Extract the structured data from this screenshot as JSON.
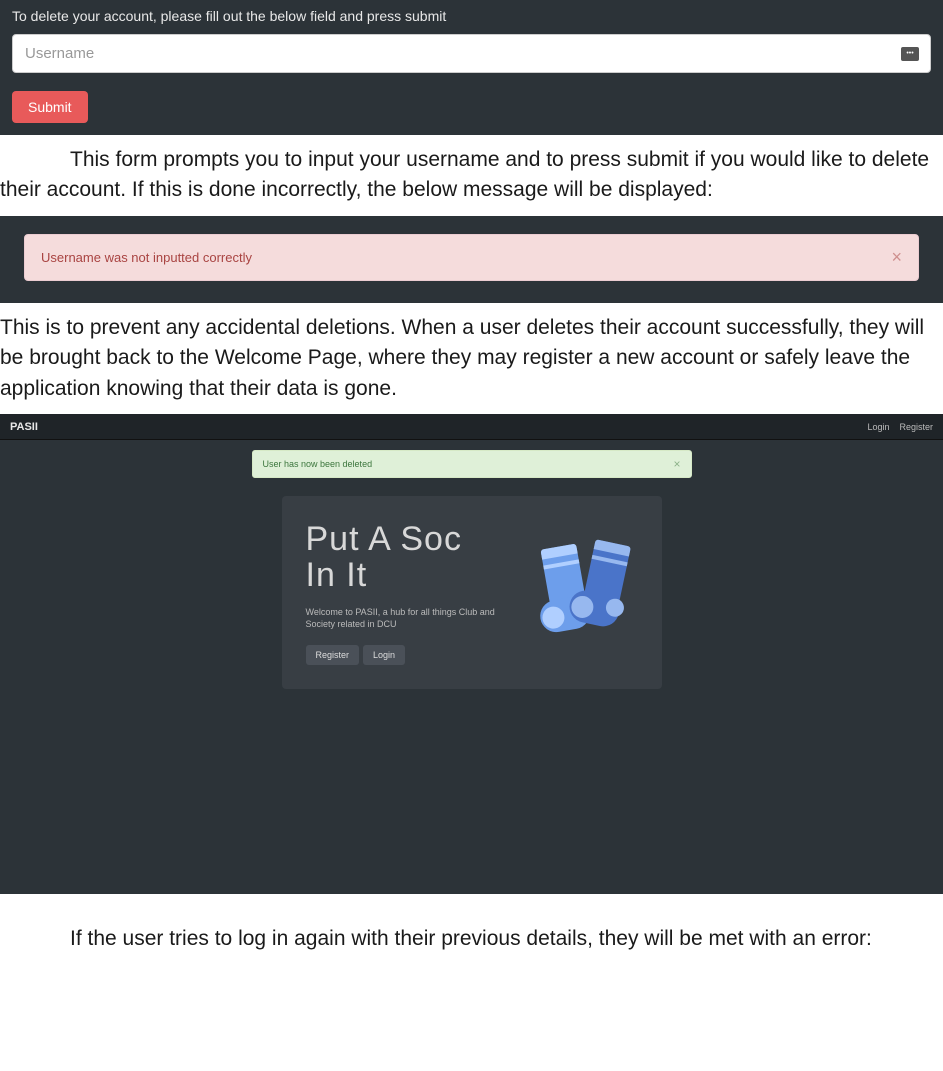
{
  "delete_form": {
    "instruction": "To delete your account, please fill out the below field and press submit",
    "placeholder": "Username",
    "submit_label": "Submit"
  },
  "para1": "This form prompts you to input your username and to press submit if you would like to delete their account. If this is done incorrectly, the below message will be displayed:",
  "error_alert": {
    "text": "Username was not inputted correctly",
    "close": "×"
  },
  "para2": "This is to prevent any accidental deletions. When a user deletes their account successfully, they will be brought back to the Welcome Page, where they may register a new account or safely leave the application knowing that their data is gone.",
  "welcome": {
    "navbar_brand": "PASII",
    "navbar_login": "Login",
    "navbar_register": "Register",
    "success_text": "User has now been deleted",
    "success_close": "×",
    "title_line1": "Put A Soc",
    "title_line2": "In It",
    "desc": "Welcome to PASII, a hub for all things Club and Society related in DCU",
    "register_btn": "Register",
    "login_btn": "Login"
  },
  "para3": "If the user tries to log in again with their previous details, they will be met with an error:"
}
